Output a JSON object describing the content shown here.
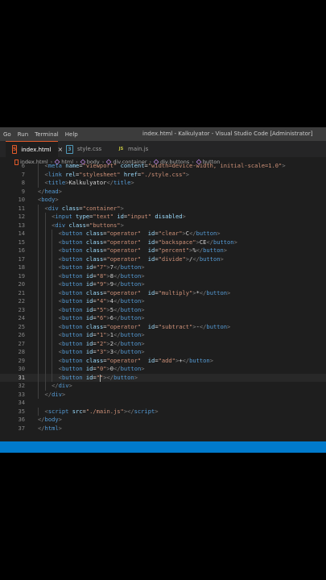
{
  "menu": [
    "Go",
    "Run",
    "Terminal",
    "Help"
  ],
  "window_title": "index.html - Kalkulyator - Visual Studio Code [Administrator]",
  "tabs": [
    {
      "label": "index.html",
      "icon": "html-file-icon",
      "icon_glyph": "5",
      "color": "#e05a2a",
      "active": true
    },
    {
      "label": "style.css",
      "icon": "css-file-icon",
      "icon_glyph": "3",
      "color": "#519aba",
      "active": false
    },
    {
      "label": "main.js",
      "icon": "js-file-icon",
      "icon_glyph": "JS",
      "color": "#cbcb41",
      "active": false
    }
  ],
  "breadcrumb": [
    "index.html",
    "html",
    "body",
    "div.container",
    "div.buttons",
    "button"
  ],
  "current_line": 31,
  "code_lines": [
    {
      "n": 6,
      "indent": 2,
      "tokens": [
        [
          "b",
          "<"
        ],
        [
          "t",
          "meta"
        ],
        [
          "x",
          " "
        ],
        [
          "a",
          "name"
        ],
        [
          "x",
          "="
        ],
        [
          "s",
          "\"viewport\""
        ],
        [
          "x",
          " "
        ],
        [
          "a",
          "content"
        ],
        [
          "x",
          "="
        ],
        [
          "s",
          "\"width=device-width, initial-scale=1.0\""
        ],
        [
          "b",
          ">"
        ]
      ]
    },
    {
      "n": 7,
      "indent": 2,
      "tokens": [
        [
          "b",
          "<"
        ],
        [
          "t",
          "link"
        ],
        [
          "x",
          " "
        ],
        [
          "a",
          "rel"
        ],
        [
          "x",
          "="
        ],
        [
          "s",
          "\"stylesheet\""
        ],
        [
          "x",
          " "
        ],
        [
          "a",
          "href"
        ],
        [
          "x",
          "="
        ],
        [
          "s",
          "\"./style.css\""
        ],
        [
          "b",
          ">"
        ]
      ]
    },
    {
      "n": 8,
      "indent": 2,
      "tokens": [
        [
          "b",
          "<"
        ],
        [
          "t",
          "title"
        ],
        [
          "b",
          ">"
        ],
        [
          "x",
          "Kalkulyator"
        ],
        [
          "b",
          "</"
        ],
        [
          "t",
          "title"
        ],
        [
          "b",
          ">"
        ]
      ]
    },
    {
      "n": 9,
      "indent": 0,
      "tokens": [
        [
          "b",
          "</"
        ],
        [
          "t",
          "head"
        ],
        [
          "b",
          ">"
        ]
      ]
    },
    {
      "n": 10,
      "indent": 0,
      "tokens": [
        [
          "b",
          "<"
        ],
        [
          "t",
          "body"
        ],
        [
          "b",
          ">"
        ]
      ]
    },
    {
      "n": 11,
      "indent": 2,
      "tokens": [
        [
          "b",
          "<"
        ],
        [
          "t",
          "div"
        ],
        [
          "x",
          " "
        ],
        [
          "a",
          "class"
        ],
        [
          "x",
          "="
        ],
        [
          "s",
          "\"container\""
        ],
        [
          "b",
          ">"
        ]
      ]
    },
    {
      "n": 12,
      "indent": 4,
      "tokens": [
        [
          "b",
          "<"
        ],
        [
          "t",
          "input"
        ],
        [
          "x",
          " "
        ],
        [
          "a",
          "type"
        ],
        [
          "x",
          "="
        ],
        [
          "s",
          "\"text\""
        ],
        [
          "x",
          " "
        ],
        [
          "a",
          "id"
        ],
        [
          "x",
          "="
        ],
        [
          "s",
          "\"input\""
        ],
        [
          "x",
          " "
        ],
        [
          "a",
          "disabled"
        ],
        [
          "b",
          ">"
        ]
      ]
    },
    {
      "n": 13,
      "indent": 4,
      "tokens": [
        [
          "b",
          "<"
        ],
        [
          "t",
          "div"
        ],
        [
          "x",
          " "
        ],
        [
          "a",
          "class"
        ],
        [
          "x",
          "="
        ],
        [
          "s",
          "\"buttons\""
        ],
        [
          "b",
          ">"
        ]
      ]
    },
    {
      "n": 14,
      "indent": 6,
      "tokens": [
        [
          "b",
          "<"
        ],
        [
          "t",
          "button"
        ],
        [
          "x",
          " "
        ],
        [
          "a",
          "class"
        ],
        [
          "x",
          "="
        ],
        [
          "s",
          "\"operator\""
        ],
        [
          "x",
          "  "
        ],
        [
          "a",
          "id"
        ],
        [
          "x",
          "="
        ],
        [
          "s",
          "\"clear\""
        ],
        [
          "b",
          ">"
        ],
        [
          "x",
          "C"
        ],
        [
          "b",
          "</"
        ],
        [
          "t",
          "button"
        ],
        [
          "b",
          ">"
        ]
      ]
    },
    {
      "n": 15,
      "indent": 6,
      "tokens": [
        [
          "b",
          "<"
        ],
        [
          "t",
          "button"
        ],
        [
          "x",
          " "
        ],
        [
          "a",
          "class"
        ],
        [
          "x",
          "="
        ],
        [
          "s",
          "\"operator\""
        ],
        [
          "x",
          "  "
        ],
        [
          "a",
          "id"
        ],
        [
          "x",
          "="
        ],
        [
          "s",
          "\"backspace\""
        ],
        [
          "b",
          ">"
        ],
        [
          "x",
          "CE"
        ],
        [
          "b",
          "</"
        ],
        [
          "t",
          "button"
        ],
        [
          "b",
          ">"
        ]
      ]
    },
    {
      "n": 16,
      "indent": 6,
      "tokens": [
        [
          "b",
          "<"
        ],
        [
          "t",
          "button"
        ],
        [
          "x",
          " "
        ],
        [
          "a",
          "class"
        ],
        [
          "x",
          "="
        ],
        [
          "s",
          "\"operator\""
        ],
        [
          "x",
          "  "
        ],
        [
          "a",
          "id"
        ],
        [
          "x",
          "="
        ],
        [
          "s",
          "\"percent\""
        ],
        [
          "b",
          ">"
        ],
        [
          "x",
          "%"
        ],
        [
          "b",
          "</"
        ],
        [
          "t",
          "button"
        ],
        [
          "b",
          ">"
        ]
      ]
    },
    {
      "n": 17,
      "indent": 6,
      "tokens": [
        [
          "b",
          "<"
        ],
        [
          "t",
          "button"
        ],
        [
          "x",
          " "
        ],
        [
          "a",
          "class"
        ],
        [
          "x",
          "="
        ],
        [
          "s",
          "\"operator\""
        ],
        [
          "x",
          "  "
        ],
        [
          "a",
          "id"
        ],
        [
          "x",
          "="
        ],
        [
          "s",
          "\"divide\""
        ],
        [
          "b",
          ">"
        ],
        [
          "x",
          "/"
        ],
        [
          "b",
          "</"
        ],
        [
          "t",
          "button"
        ],
        [
          "b",
          ">"
        ]
      ]
    },
    {
      "n": 18,
      "indent": 6,
      "tokens": [
        [
          "b",
          "<"
        ],
        [
          "t",
          "button"
        ],
        [
          "x",
          " "
        ],
        [
          "a",
          "id"
        ],
        [
          "x",
          "="
        ],
        [
          "s",
          "\"7\""
        ],
        [
          "b",
          ">"
        ],
        [
          "x",
          "7"
        ],
        [
          "b",
          "</"
        ],
        [
          "t",
          "button"
        ],
        [
          "b",
          ">"
        ]
      ]
    },
    {
      "n": 19,
      "indent": 6,
      "tokens": [
        [
          "b",
          "<"
        ],
        [
          "t",
          "button"
        ],
        [
          "x",
          " "
        ],
        [
          "a",
          "id"
        ],
        [
          "x",
          "="
        ],
        [
          "s",
          "\"8\""
        ],
        [
          "b",
          ">"
        ],
        [
          "x",
          "8"
        ],
        [
          "b",
          "</"
        ],
        [
          "t",
          "button"
        ],
        [
          "b",
          ">"
        ]
      ]
    },
    {
      "n": 20,
      "indent": 6,
      "tokens": [
        [
          "b",
          "<"
        ],
        [
          "t",
          "button"
        ],
        [
          "x",
          " "
        ],
        [
          "a",
          "id"
        ],
        [
          "x",
          "="
        ],
        [
          "s",
          "\"9\""
        ],
        [
          "b",
          ">"
        ],
        [
          "x",
          "9"
        ],
        [
          "b",
          "</"
        ],
        [
          "t",
          "button"
        ],
        [
          "b",
          ">"
        ]
      ]
    },
    {
      "n": 21,
      "indent": 6,
      "tokens": [
        [
          "b",
          "<"
        ],
        [
          "t",
          "button"
        ],
        [
          "x",
          " "
        ],
        [
          "a",
          "class"
        ],
        [
          "x",
          "="
        ],
        [
          "s",
          "\"operator\""
        ],
        [
          "x",
          "  "
        ],
        [
          "a",
          "id"
        ],
        [
          "x",
          "="
        ],
        [
          "s",
          "\"multiply\""
        ],
        [
          "b",
          ">"
        ],
        [
          "x",
          "*"
        ],
        [
          "b",
          "</"
        ],
        [
          "t",
          "button"
        ],
        [
          "b",
          ">"
        ]
      ]
    },
    {
      "n": 22,
      "indent": 6,
      "tokens": [
        [
          "b",
          "<"
        ],
        [
          "t",
          "button"
        ],
        [
          "x",
          " "
        ],
        [
          "a",
          "id"
        ],
        [
          "x",
          "="
        ],
        [
          "s",
          "\"4\""
        ],
        [
          "b",
          ">"
        ],
        [
          "x",
          "4"
        ],
        [
          "b",
          "</"
        ],
        [
          "t",
          "button"
        ],
        [
          "b",
          ">"
        ]
      ]
    },
    {
      "n": 23,
      "indent": 6,
      "tokens": [
        [
          "b",
          "<"
        ],
        [
          "t",
          "button"
        ],
        [
          "x",
          " "
        ],
        [
          "a",
          "id"
        ],
        [
          "x",
          "="
        ],
        [
          "s",
          "\"5\""
        ],
        [
          "b",
          ">"
        ],
        [
          "x",
          "5"
        ],
        [
          "b",
          "</"
        ],
        [
          "t",
          "button"
        ],
        [
          "b",
          ">"
        ]
      ]
    },
    {
      "n": 24,
      "indent": 6,
      "tokens": [
        [
          "b",
          "<"
        ],
        [
          "t",
          "button"
        ],
        [
          "x",
          " "
        ],
        [
          "a",
          "id"
        ],
        [
          "x",
          "="
        ],
        [
          "s",
          "\"6\""
        ],
        [
          "b",
          ">"
        ],
        [
          "x",
          "6"
        ],
        [
          "b",
          "</"
        ],
        [
          "t",
          "button"
        ],
        [
          "b",
          ">"
        ]
      ]
    },
    {
      "n": 25,
      "indent": 6,
      "tokens": [
        [
          "b",
          "<"
        ],
        [
          "t",
          "button"
        ],
        [
          "x",
          " "
        ],
        [
          "a",
          "class"
        ],
        [
          "x",
          "="
        ],
        [
          "s",
          "\"operator\""
        ],
        [
          "x",
          "  "
        ],
        [
          "a",
          "id"
        ],
        [
          "x",
          "="
        ],
        [
          "s",
          "\"subtract\""
        ],
        [
          "b",
          ">"
        ],
        [
          "x",
          "-"
        ],
        [
          "b",
          "</"
        ],
        [
          "t",
          "button"
        ],
        [
          "b",
          ">"
        ]
      ]
    },
    {
      "n": 26,
      "indent": 6,
      "tokens": [
        [
          "b",
          "<"
        ],
        [
          "t",
          "button"
        ],
        [
          "x",
          " "
        ],
        [
          "a",
          "id"
        ],
        [
          "x",
          "="
        ],
        [
          "s",
          "\"1\""
        ],
        [
          "b",
          ">"
        ],
        [
          "x",
          "1"
        ],
        [
          "b",
          "</"
        ],
        [
          "t",
          "button"
        ],
        [
          "b",
          ">"
        ]
      ]
    },
    {
      "n": 27,
      "indent": 6,
      "tokens": [
        [
          "b",
          "<"
        ],
        [
          "t",
          "button"
        ],
        [
          "x",
          " "
        ],
        [
          "a",
          "id"
        ],
        [
          "x",
          "="
        ],
        [
          "s",
          "\"2\""
        ],
        [
          "b",
          ">"
        ],
        [
          "x",
          "2"
        ],
        [
          "b",
          "</"
        ],
        [
          "t",
          "button"
        ],
        [
          "b",
          ">"
        ]
      ]
    },
    {
      "n": 28,
      "indent": 6,
      "tokens": [
        [
          "b",
          "<"
        ],
        [
          "t",
          "button"
        ],
        [
          "x",
          " "
        ],
        [
          "a",
          "id"
        ],
        [
          "x",
          "="
        ],
        [
          "s",
          "\"3\""
        ],
        [
          "b",
          ">"
        ],
        [
          "x",
          "3"
        ],
        [
          "b",
          "</"
        ],
        [
          "t",
          "button"
        ],
        [
          "b",
          ">"
        ]
      ]
    },
    {
      "n": 29,
      "indent": 6,
      "tokens": [
        [
          "b",
          "<"
        ],
        [
          "t",
          "button"
        ],
        [
          "x",
          " "
        ],
        [
          "a",
          "class"
        ],
        [
          "x",
          "="
        ],
        [
          "s",
          "\"operator\""
        ],
        [
          "x",
          "  "
        ],
        [
          "a",
          "id"
        ],
        [
          "x",
          "="
        ],
        [
          "s",
          "\"add\""
        ],
        [
          "b",
          ">"
        ],
        [
          "x",
          "+"
        ],
        [
          "b",
          "</"
        ],
        [
          "t",
          "button"
        ],
        [
          "b",
          ">"
        ]
      ]
    },
    {
      "n": 30,
      "indent": 6,
      "tokens": [
        [
          "b",
          "<"
        ],
        [
          "t",
          "button"
        ],
        [
          "x",
          " "
        ],
        [
          "a",
          "id"
        ],
        [
          "x",
          "="
        ],
        [
          "s",
          "\"0\""
        ],
        [
          "b",
          ">"
        ],
        [
          "x",
          "0"
        ],
        [
          "b",
          "</"
        ],
        [
          "t",
          "button"
        ],
        [
          "b",
          ">"
        ]
      ]
    },
    {
      "n": 31,
      "indent": 6,
      "tokens": [
        [
          "b",
          "<"
        ],
        [
          "t",
          "button"
        ],
        [
          "x",
          " "
        ],
        [
          "a",
          "id"
        ],
        [
          "x",
          "="
        ],
        [
          "s",
          "\"\""
        ],
        [
          "b",
          ">"
        ],
        [
          "b",
          "</"
        ],
        [
          "t",
          "button"
        ],
        [
          "b",
          ">"
        ]
      ]
    },
    {
      "n": 32,
      "indent": 4,
      "tokens": [
        [
          "b",
          "</"
        ],
        [
          "t",
          "div"
        ],
        [
          "b",
          ">"
        ]
      ]
    },
    {
      "n": 33,
      "indent": 2,
      "tokens": [
        [
          "b",
          "</"
        ],
        [
          "t",
          "div"
        ],
        [
          "b",
          ">"
        ]
      ]
    },
    {
      "n": 34,
      "indent": 0,
      "tokens": []
    },
    {
      "n": 35,
      "indent": 2,
      "tokens": [
        [
          "b",
          "<"
        ],
        [
          "t",
          "script"
        ],
        [
          "x",
          " "
        ],
        [
          "a",
          "src"
        ],
        [
          "x",
          "="
        ],
        [
          "s",
          "\"./main.js\""
        ],
        [
          "b",
          "></"
        ],
        [
          "t",
          "script"
        ],
        [
          "b",
          ">"
        ]
      ]
    },
    {
      "n": 36,
      "indent": 0,
      "tokens": [
        [
          "b",
          "</"
        ],
        [
          "t",
          "body"
        ],
        [
          "b",
          ">"
        ]
      ]
    },
    {
      "n": 37,
      "indent": 0,
      "tokens": [
        [
          "b",
          "</"
        ],
        [
          "t",
          "html"
        ],
        [
          "b",
          ">"
        ]
      ]
    }
  ],
  "colors": {
    "tag": "#569cd6",
    "bracket": "#808080",
    "attr": "#9cdcfe",
    "string": "#ce9178",
    "text": "#d4d4d4",
    "statusbar": "#007acc"
  }
}
